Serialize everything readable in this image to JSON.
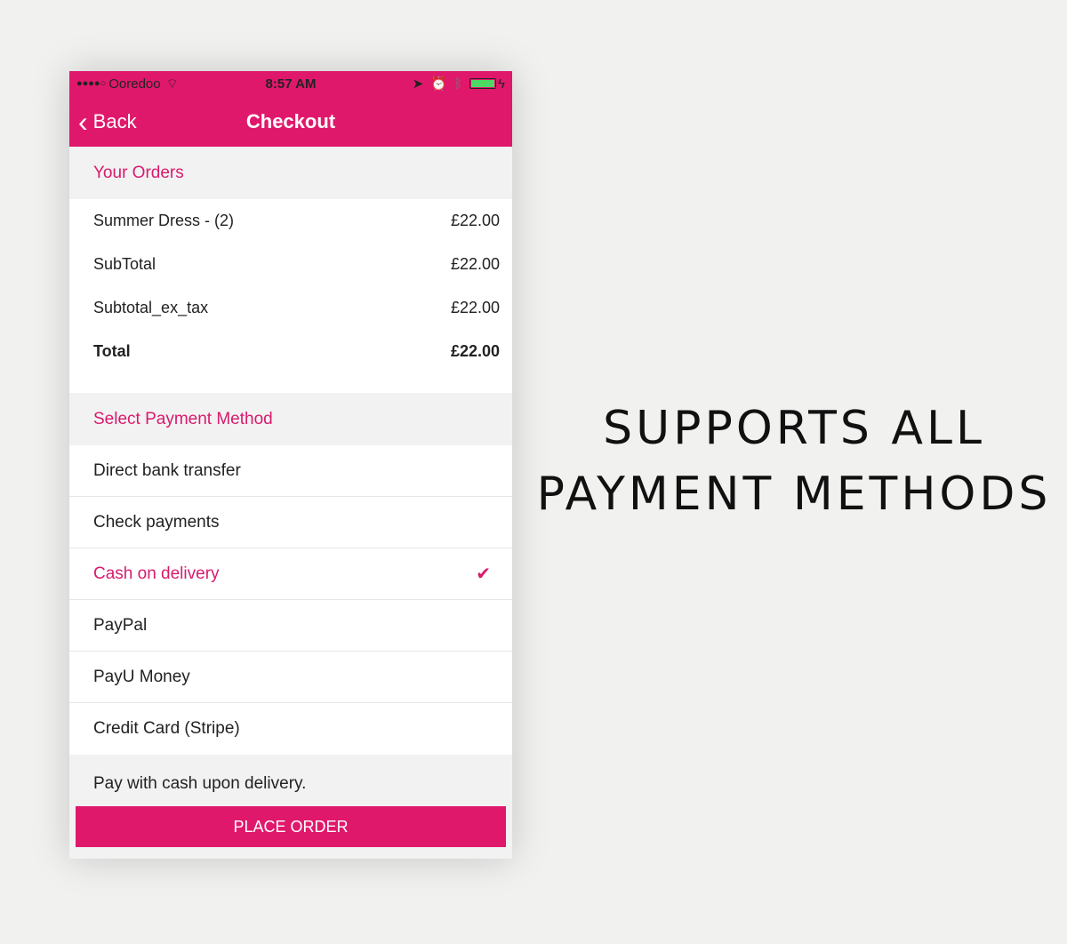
{
  "status": {
    "signal": "●●●●○",
    "carrier": "Ooredoo",
    "time": "8:57 AM"
  },
  "nav": {
    "back": "Back",
    "title": "Checkout"
  },
  "orders": {
    "header": "Your Orders",
    "rows": [
      {
        "label": "Summer Dress - (2)",
        "value": "£22.00"
      },
      {
        "label": "SubTotal",
        "value": "£22.00"
      },
      {
        "label": "Subtotal_ex_tax",
        "value": "£22.00"
      },
      {
        "label": "Total",
        "value": "£22.00"
      }
    ]
  },
  "payment": {
    "header": "Select Payment Method",
    "methods": [
      "Direct bank transfer",
      "Check payments",
      "Cash on delivery",
      "PayPal",
      "PayU Money",
      "Credit Card (Stripe)"
    ],
    "selected": "Cash on delivery",
    "description": "Pay with cash upon delivery."
  },
  "place_order": "PLACE ORDER",
  "tagline": {
    "line1": "SUPPORTS ALL",
    "line2": "PAYMENT METHODS"
  },
  "colors": {
    "accent": "#e0186c"
  }
}
